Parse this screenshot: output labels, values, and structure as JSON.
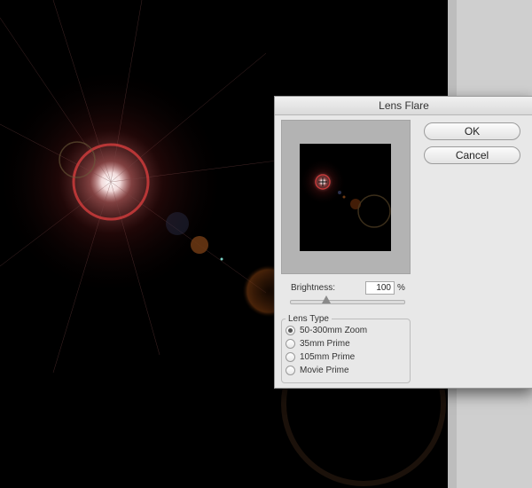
{
  "dialog": {
    "title": "Lens Flare",
    "ok_label": "OK",
    "cancel_label": "Cancel",
    "brightness_label": "Brightness:",
    "brightness_value": "100",
    "brightness_unit": "%",
    "lens_type_title": "Lens Type",
    "lens_options": [
      {
        "label": "50-300mm Zoom",
        "selected": true
      },
      {
        "label": "35mm Prime",
        "selected": false
      },
      {
        "label": "105mm Prime",
        "selected": false
      },
      {
        "label": "Movie Prime",
        "selected": false
      }
    ]
  },
  "colors": {
    "flare_core": "#ffffff",
    "flare_ring": "#c43a3a",
    "flare_glow": "#7a1c1c",
    "canvas_bg": "#000000",
    "dialog_bg": "#e8e8e8"
  }
}
